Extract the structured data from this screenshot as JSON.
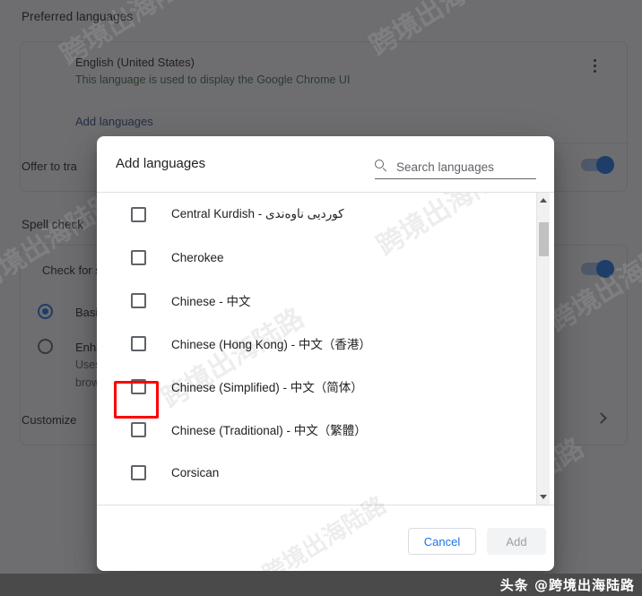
{
  "background": {
    "section_title": "Preferred languages",
    "language_name": "English (United States)",
    "language_sub": "This language is used to display the Google Chrome UI",
    "add_languages_link": "Add languages",
    "offer_translate_label": "Offer to tra",
    "spellcheck_title": "Spell check",
    "check_for_label": "Check for s",
    "basic_label": "Basi",
    "enhanced_label": "Enha",
    "enhanced_sub1": "Uses",
    "enhanced_sub2": "brow",
    "customize_label": "Customize",
    "accent_color": "#1a73e8",
    "link_color": "#2d4a86"
  },
  "dialog": {
    "title": "Add languages",
    "search": {
      "placeholder": "Search languages",
      "value": ""
    },
    "languages": [
      {
        "label": "Central Kurdish - کوردیی ناوەندی",
        "checked": false,
        "highlighted": false
      },
      {
        "label": "Cherokee",
        "checked": false,
        "highlighted": false
      },
      {
        "label": "Chinese - 中文",
        "checked": false,
        "highlighted": false
      },
      {
        "label": "Chinese (Hong Kong) - 中文（香港）",
        "checked": false,
        "highlighted": false
      },
      {
        "label": "Chinese (Simplified) - 中文（简体）",
        "checked": false,
        "highlighted": true
      },
      {
        "label": "Chinese (Traditional) - 中文（繁體）",
        "checked": false,
        "highlighted": false
      },
      {
        "label": "Corsican",
        "checked": false,
        "highlighted": false
      }
    ],
    "buttons": {
      "cancel": "Cancel",
      "add": "Add"
    },
    "highlight_color": "#ff0000"
  },
  "watermarks": {
    "text": "跨境出海陆路",
    "bottom_bar": "头条 @跨境出海陆路"
  }
}
